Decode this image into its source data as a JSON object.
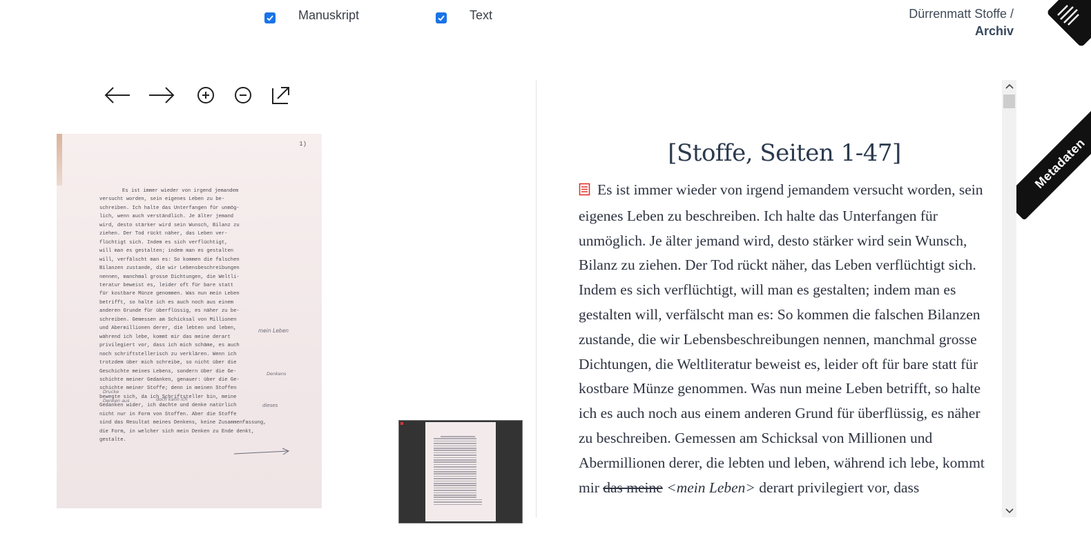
{
  "toggles": {
    "manuscript": {
      "label": "Manuskript",
      "checked": true
    },
    "text": {
      "label": "Text",
      "checked": true
    }
  },
  "breadcrumb": {
    "parent": "Dürrenmatt Stoffe /",
    "current": "Archiv"
  },
  "menu": {
    "icon": "hamburger-menu-icon"
  },
  "metadata_tab": {
    "label": "Metadaten"
  },
  "viewer_toolbar": {
    "prev_icon": "arrow-left-icon",
    "next_icon": "arrow-right-icon",
    "zoom_in_icon": "zoom-in-icon",
    "zoom_out_icon": "zoom-out-icon",
    "open_external_icon": "external-link-icon"
  },
  "manuscript": {
    "page_number": "1)",
    "lines": [
      "Es ist immer wieder von irgend jemandem",
      "versucht worden, sein eigenes Leben zu be-",
      "schreiben. Ich halte das Unterfangen für unmög-",
      "lich, wenn auch verständlich. Je älter jemand",
      "wird, desto stärker wird sein Wunsch, Bilanz zu",
      "ziehen. Der Tod rückt näher, das Leben ver-",
      "flüchtigt sich. Indem es sich verflüchtigt,",
      "will man es gestalten; indem man es gestalten",
      "will, verfälscht man es: So kommen die falschen",
      "Bilanzen zustande, die wir Lebensbeschreibungen",
      "nennen, manchmal grosse Dichtungen, die Weltli-",
      "teratur beweist es, leider oft für bare statt",
      "für kostbare Münze genommen. Was nun mein Leben",
      "betrifft, so halte ich es auch noch aus einem",
      "anderen Grunde für überflüssig, es näher zu be-",
      "schreiben. Gemessen am Schicksal von Millionen",
      "und Abermillionen derer, die lebten und leben,",
      "während ich lebe, kommt mir das meine derart",
      "privilegiert vor, dass ich mich schäme, es auch",
      "noch schriftstellerisch zu verklären. Wenn ich",
      "trotzdem über mich schreibe, so nicht über die",
      "Geschichte meines Lebens, sondern über die Ge-",
      "schichte meiner Gedanken, genauer: über die Ge-",
      "schichte meiner Stoffe; denn in meinen Stoffen",
      "bewegte sich, da ich Schriftsteller bin, meine",
      "Gedanken wider, ich dachte und denke natürlich",
      "nicht nur in Form von Stoffen. Aber die Stoffe",
      "sind das Resultat meines Denkens, keine Zusammenfassung,",
      "die Form, in welcher sich mein Denken zu Ende denkt,",
      "gestalte."
    ],
    "notes": {
      "note1": "mein Leben",
      "note2": "Denkens",
      "note3": "Drucke",
      "note4": "dieses",
      "note5": "Denken aus",
      "note6": "doch kann ich"
    }
  },
  "thumbnail": {
    "label": "page-overview"
  },
  "transcription": {
    "title": "[Stoffe, Seiten 1-47]",
    "icon": "document-icon",
    "icon_color": "#e0302a",
    "paragraph_before_strike": "Es ist immer wieder von irgend jemandem versucht worden, sein eigenes Leben zu beschreiben. Ich halte das Unterfangen für unmöglich. Je älter jemand wird, desto stärker wird sein Wunsch, Bilanz zu ziehen. Der Tod rückt näher, das Leben verflüchtigt sich. Indem es sich verflüchtigt, will man es gestalten; indem man es gestalten will, verfälscht man es: So kommen die falschen Bilanzen zustande, die wir Lebensbeschreibungen nennen, manchmal grosse Dichtungen, die Weltliteratur beweist es, leider oft für bare statt für kostbare Münze genommen. Was nun meine Leben betrifft, so halte ich es auch noch aus einem anderen Grund für überflüssig, es näher zu beschreiben. Gemessen am Schicksal von Millionen und Abermillionen derer, die lebten und leben, während ich lebe, kommt mir ",
    "deleted": "das meine",
    "added": "<mein Leben>",
    "paragraph_after": " derart privilegiert vor, dass"
  },
  "scrollbar": {
    "up_icon": "chevron-up-icon",
    "down_icon": "chevron-down-icon"
  },
  "colors": {
    "accent": "#1a73e8",
    "ribbon": "#111111",
    "title": "#2b3a4e"
  }
}
